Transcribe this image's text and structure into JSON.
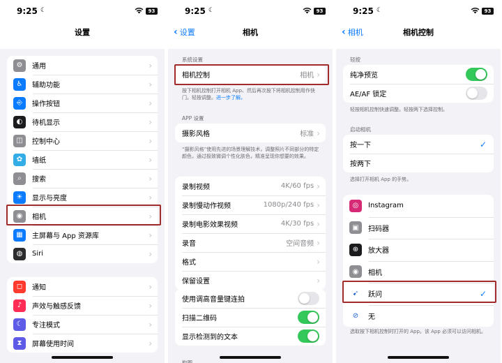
{
  "status": {
    "time": "9:25",
    "battery": "93"
  },
  "screen1": {
    "title": "设置",
    "group1": [
      {
        "label": "通用",
        "icon": "gear-icon",
        "color": "#8e8e93",
        "glyph": "⚙"
      },
      {
        "label": "辅助功能",
        "icon": "accessibility-icon",
        "color": "#0a7aff",
        "glyph": "♿"
      },
      {
        "label": "操作按钮",
        "icon": "action-button-icon",
        "color": "#0a7aff",
        "glyph": "⎆"
      },
      {
        "label": "待机显示",
        "icon": "standby-icon",
        "color": "#1c1c1e",
        "glyph": "◐"
      },
      {
        "label": "控制中心",
        "icon": "control-center-icon",
        "color": "#8e8e93",
        "glyph": "◫"
      },
      {
        "label": "墙纸",
        "icon": "wallpaper-icon",
        "color": "#32ade6",
        "glyph": "✿"
      },
      {
        "label": "搜索",
        "icon": "search-icon",
        "color": "#8e8e93",
        "glyph": "⌕"
      },
      {
        "label": "显示与亮度",
        "icon": "brightness-icon",
        "color": "#0a7aff",
        "glyph": "☀"
      },
      {
        "label": "相机",
        "icon": "camera-icon",
        "color": "#8e8e93",
        "glyph": "◉"
      },
      {
        "label": "主屏幕与 App 资源库",
        "icon": "home-screen-icon",
        "color": "#0a7aff",
        "glyph": "▦"
      },
      {
        "label": "Siri",
        "icon": "siri-icon",
        "color": "#2c2c2e",
        "glyph": "◍"
      }
    ],
    "group2": [
      {
        "label": "通知",
        "icon": "notification-icon",
        "color": "#ff3b30",
        "glyph": "◻"
      },
      {
        "label": "声效与触感反馈",
        "icon": "sound-icon",
        "color": "#ff2d55",
        "glyph": "♪"
      },
      {
        "label": "专注模式",
        "icon": "focus-moon-icon",
        "color": "#5e5ce6",
        "glyph": "☾"
      },
      {
        "label": "屏幕使用时间",
        "icon": "screen-time-icon",
        "color": "#5e5ce6",
        "glyph": "⧗"
      }
    ]
  },
  "screen2": {
    "back": "设置",
    "title": "相机",
    "section_system": "系统设置",
    "camera_control": {
      "label": "相机控制",
      "value": "相机"
    },
    "camera_control_footer": "按下相机控制打开相机 App、然后再次按下将相机控制用作快门。轻按调整。",
    "camera_control_link": "进一步了解。",
    "section_app": "APP 设置",
    "photo_style": {
      "label": "摄影风格",
      "value": "标准"
    },
    "photo_style_footer": "“摄影风格”使用先进的场景理解技术，调整照片不同部分的特定颜色，通过极致微调个性化肤色，精准呈现你想要的效果。",
    "rows": [
      {
        "label": "录制视频",
        "value": "4K/60 fps"
      },
      {
        "label": "录制慢动作视频",
        "value": "1080p/240 fps"
      },
      {
        "label": "录制电影效果视频",
        "value": "4K/30 fps"
      },
      {
        "label": "录音",
        "value": "空间音频"
      },
      {
        "label": "格式",
        "value": ""
      },
      {
        "label": "保留设置",
        "value": ""
      }
    ],
    "toggles": [
      {
        "label": "使用调高音量键连拍",
        "on": false
      },
      {
        "label": "扫描二维码",
        "on": true
      },
      {
        "label": "显示检测到的文本",
        "on": true
      }
    ],
    "bottom_cut": "构图"
  },
  "screen3": {
    "back": "相机",
    "title": "相机控制",
    "section_tap": "轻按",
    "toggles": [
      {
        "label": "纯净预览",
        "on": true
      },
      {
        "label": "AE/AF 锁定",
        "on": false
      }
    ],
    "tap_footer": "轻按相机控制快速调整。轻按两下选择控制。",
    "section_launch": "启动相机",
    "launch": [
      {
        "label": "按一下",
        "checked": true
      },
      {
        "label": "按两下",
        "checked": false
      }
    ],
    "launch_footer": "选择打开相机 App 的手势。",
    "apps": [
      {
        "label": "Instagram",
        "icon": "instagram-icon",
        "color": "#d62976",
        "glyph": "◎",
        "checked": false
      },
      {
        "label": "扫码器",
        "icon": "qr-scanner-icon",
        "color": "#8e8e93",
        "glyph": "▣",
        "checked": false
      },
      {
        "label": "放大器",
        "icon": "magnifier-icon",
        "color": "#1c1c1e",
        "glyph": "⊕",
        "checked": false
      },
      {
        "label": "相机",
        "icon": "camera-icon",
        "color": "#8e8e93",
        "glyph": "◉",
        "checked": false
      },
      {
        "label": "跃问",
        "icon": "yuewen-app-icon",
        "color": "#ffffff",
        "glyph": "➹",
        "checked": true
      },
      {
        "label": "无",
        "icon": "none-icon",
        "color": "#ffffff",
        "glyph": "⊘",
        "checked": false
      }
    ],
    "apps_footer": "选取按下相机控制时打开的 App。该 App 必须可以访问相机。"
  },
  "colors": {
    "accent": "#0a7aff",
    "highlight": "#a12a2a",
    "toggle_on": "#34c759"
  }
}
